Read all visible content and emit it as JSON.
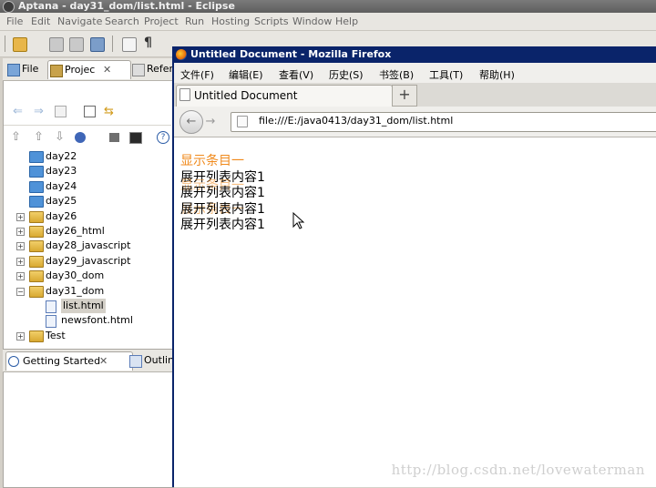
{
  "eclipse": {
    "title": "Aptana - day31_dom/list.html - Eclipse",
    "menu": [
      "File",
      "Edit",
      "Navigate",
      "Search",
      "Project",
      "Run",
      "Hosting",
      "Scripts",
      "Window",
      "Help"
    ],
    "left_tabs": [
      "File",
      "Projec",
      "Refer"
    ],
    "tree": [
      {
        "label": "day22",
        "type": "folder",
        "expander": ""
      },
      {
        "label": "day23",
        "type": "folder",
        "expander": ""
      },
      {
        "label": "day24",
        "type": "folder",
        "expander": ""
      },
      {
        "label": "day25",
        "type": "folder",
        "expander": ""
      },
      {
        "label": "day26",
        "type": "project",
        "expander": "+"
      },
      {
        "label": "day26_html",
        "type": "project",
        "expander": "+"
      },
      {
        "label": "day28_javascript",
        "type": "project",
        "expander": "+"
      },
      {
        "label": "day29_javascript",
        "type": "project",
        "expander": "+"
      },
      {
        "label": "day30_dom",
        "type": "project",
        "expander": "+"
      },
      {
        "label": "day31_dom",
        "type": "project",
        "expander": "−"
      },
      {
        "label": "list.html",
        "type": "file",
        "expander": ""
      },
      {
        "label": "newsfont.html",
        "type": "file",
        "expander": ""
      },
      {
        "label": "Test",
        "type": "project",
        "expander": "+"
      }
    ],
    "bottom_tabs": [
      "Getting Started",
      "Outlin"
    ]
  },
  "firefox": {
    "title": "Untitled Document - Mozilla Firefox",
    "menu": [
      "文件(F)",
      "编辑(E)",
      "查看(V)",
      "历史(S)",
      "书签(B)",
      "工具(T)",
      "帮助(H)"
    ],
    "tab_label": "Untitled Document",
    "new_tab": "+",
    "url": "file:///E:/java0413/day31_dom/list.html",
    "back": "←",
    "forward": "→"
  },
  "page": {
    "heading": "显示条目一",
    "items": [
      "展开列表内容1",
      "展开列表内容1",
      "展开列表内容1",
      "展开列表内容1"
    ],
    "ghost_heading": "显示条目一"
  },
  "watermark": "http://blog.csdn.net/lovewaterman",
  "colors": {
    "heading": "#f08a1c",
    "ff_title": "#0a246a",
    "eclipse_title": "#666666"
  }
}
